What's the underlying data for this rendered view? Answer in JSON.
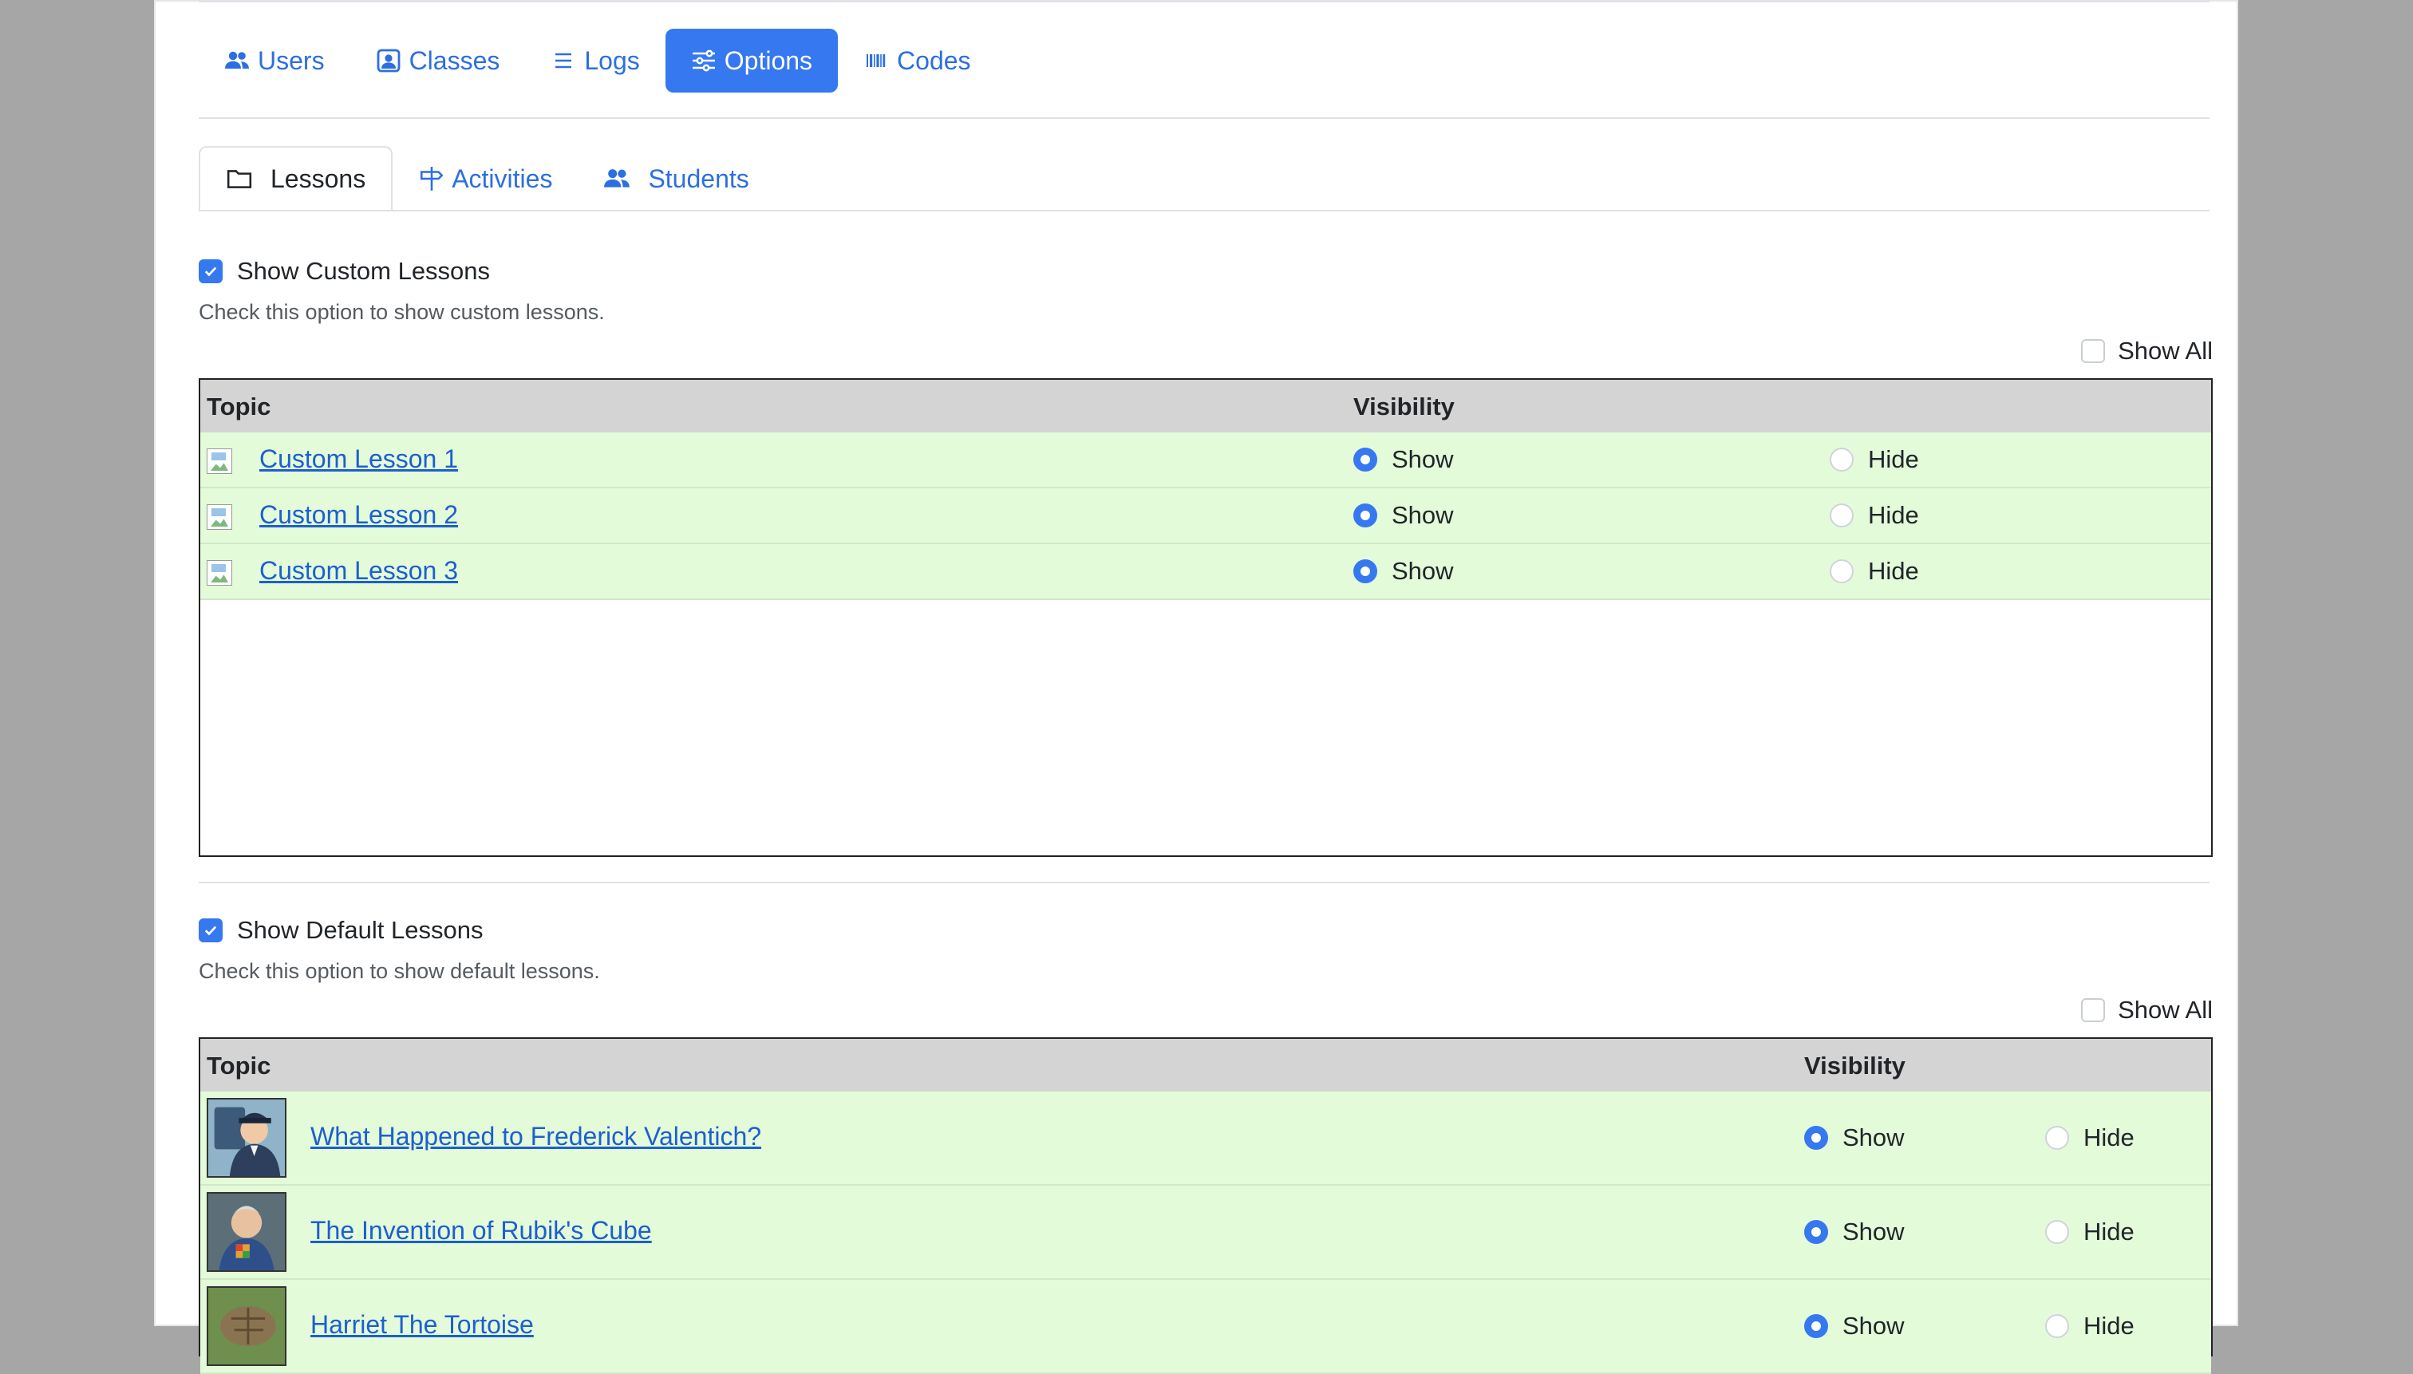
{
  "nav": {
    "items": [
      {
        "label": "Users",
        "icon": "users-icon"
      },
      {
        "label": "Classes",
        "icon": "person-badge-icon"
      },
      {
        "label": "Logs",
        "icon": "list-icon"
      },
      {
        "label": "Options",
        "icon": "sliders-icon",
        "active": true
      },
      {
        "label": "Codes",
        "icon": "barcode-icon"
      }
    ]
  },
  "subtabs": {
    "items": [
      {
        "label": "Lessons",
        "icon": "folder-icon",
        "active": true
      },
      {
        "label": "Activities",
        "icon": "signpost-icon"
      },
      {
        "label": "Students",
        "icon": "users-icon"
      }
    ]
  },
  "custom": {
    "option_label": "Show Custom Lessons",
    "option_checked": true,
    "help": "Check this option to show custom lessons.",
    "show_all": "Show All",
    "col_topic": "Topic",
    "col_visibility": "Visibility",
    "rows": [
      {
        "title": "Custom Lesson 1",
        "show": "Show",
        "hide": "Hide",
        "value": "show"
      },
      {
        "title": "Custom Lesson 2",
        "show": "Show",
        "hide": "Hide",
        "value": "show"
      },
      {
        "title": "Custom Lesson 3",
        "show": "Show",
        "hide": "Hide",
        "value": "show"
      }
    ]
  },
  "default": {
    "option_label": "Show Default Lessons",
    "option_checked": true,
    "help": "Check this option to show default lessons.",
    "show_all": "Show All",
    "col_topic": "Topic",
    "col_visibility": "Visibility",
    "rows": [
      {
        "title": "What Happened to Frederick Valentich?",
        "show": "Show",
        "hide": "Hide",
        "value": "show"
      },
      {
        "title": "The Invention of Rubik's Cube",
        "show": "Show",
        "hide": "Hide",
        "value": "show"
      },
      {
        "title": "Harriet The Tortoise",
        "show": "Show",
        "hide": "Hide",
        "value": "show"
      }
    ]
  },
  "colors": {
    "accent": "#3578f0",
    "link": "#1d5fd0",
    "row_bg": "#e3fbd9",
    "header_bg": "#d4d4d4",
    "backdrop": "#a6a6a6"
  }
}
